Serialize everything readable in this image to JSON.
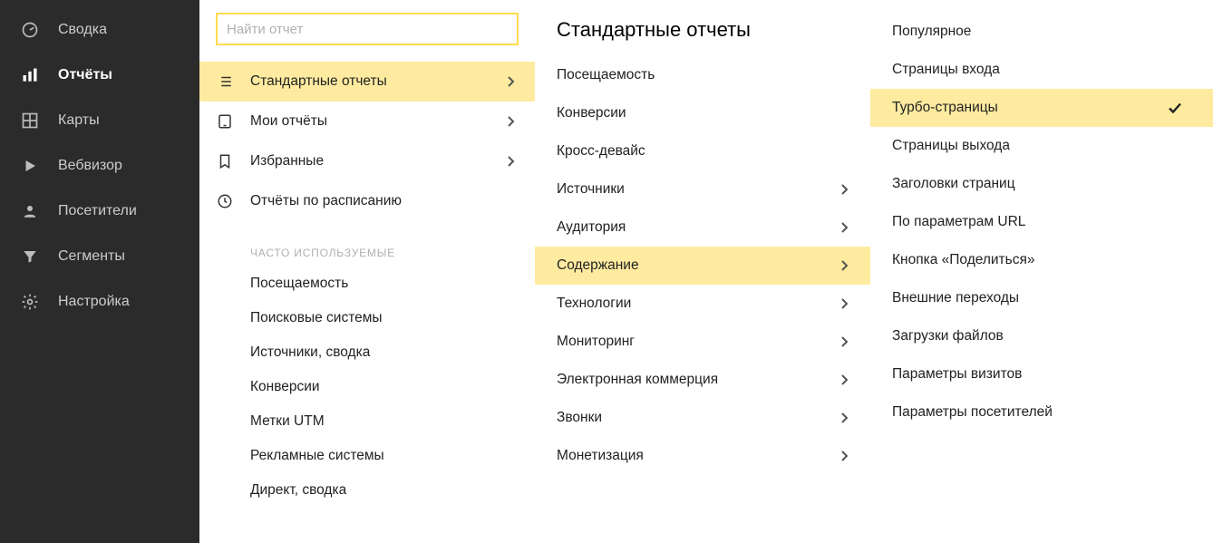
{
  "sidebar": {
    "items": [
      {
        "name": "summary",
        "label": "Сводка",
        "icon": "gauge-icon",
        "active": false
      },
      {
        "name": "reports",
        "label": "Отчёты",
        "icon": "bars-icon",
        "active": true
      },
      {
        "name": "maps",
        "label": "Карты",
        "icon": "grid-icon",
        "active": false
      },
      {
        "name": "webvisor",
        "label": "Вебвизор",
        "icon": "play-icon",
        "active": false
      },
      {
        "name": "visitors",
        "label": "Посетители",
        "icon": "person-icon",
        "active": false
      },
      {
        "name": "segments",
        "label": "Сегменты",
        "icon": "funnel-icon",
        "active": false
      },
      {
        "name": "settings",
        "label": "Настройка",
        "icon": "gear-icon",
        "active": false
      }
    ]
  },
  "search": {
    "placeholder": "Найти отчет"
  },
  "col1": {
    "items": [
      {
        "name": "standard-reports",
        "label": "Стандартные отчеты",
        "icon": "list-icon",
        "expandable": true,
        "selected": true
      },
      {
        "name": "my-reports",
        "label": "Мои отчёты",
        "icon": "tablet-icon",
        "expandable": true,
        "selected": false
      },
      {
        "name": "favorites",
        "label": "Избранные",
        "icon": "bookmark-icon",
        "expandable": true,
        "selected": false
      },
      {
        "name": "scheduled-reports",
        "label": "Отчёты по расписанию",
        "icon": "clock-icon",
        "expandable": false,
        "selected": false
      }
    ],
    "frequent_header": "ЧАСТО ИСПОЛЬЗУЕМЫЕ",
    "frequent": [
      {
        "label": "Посещаемость"
      },
      {
        "label": "Поисковые системы"
      },
      {
        "label": "Источники, сводка"
      },
      {
        "label": "Конверсии"
      },
      {
        "label": "Метки UTM"
      },
      {
        "label": "Рекламные системы"
      },
      {
        "label": "Директ, сводка"
      }
    ]
  },
  "col2": {
    "title": "Стандартные отчеты",
    "items": [
      {
        "label": "Посещаемость",
        "expandable": false,
        "selected": false
      },
      {
        "label": "Конверсии",
        "expandable": false,
        "selected": false
      },
      {
        "label": "Кросс-девайс",
        "expandable": false,
        "selected": false
      },
      {
        "label": "Источники",
        "expandable": true,
        "selected": false
      },
      {
        "label": "Аудитория",
        "expandable": true,
        "selected": false
      },
      {
        "label": "Содержание",
        "expandable": true,
        "selected": true
      },
      {
        "label": "Технологии",
        "expandable": true,
        "selected": false
      },
      {
        "label": "Мониторинг",
        "expandable": true,
        "selected": false
      },
      {
        "label": "Электронная коммерция",
        "expandable": true,
        "selected": false
      },
      {
        "label": "Звонки",
        "expandable": true,
        "selected": false
      },
      {
        "label": "Монетизация",
        "expandable": true,
        "selected": false
      }
    ]
  },
  "col3": {
    "items": [
      {
        "label": "Популярное",
        "selected": false
      },
      {
        "label": "Страницы входа",
        "selected": false
      },
      {
        "label": "Турбо-страницы",
        "selected": true
      },
      {
        "label": "Страницы выхода",
        "selected": false
      },
      {
        "label": "Заголовки страниц",
        "selected": false
      },
      {
        "label": "По параметрам URL",
        "selected": false
      },
      {
        "label": "Кнопка «Поделиться»",
        "selected": false
      },
      {
        "label": "Внешние переходы",
        "selected": false
      },
      {
        "label": "Загрузки файлов",
        "selected": false
      },
      {
        "label": "Параметры визитов",
        "selected": false
      },
      {
        "label": "Параметры посетителей",
        "selected": false
      }
    ]
  }
}
